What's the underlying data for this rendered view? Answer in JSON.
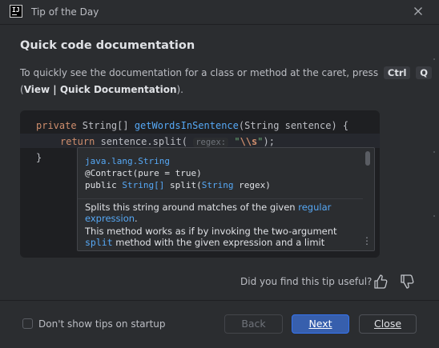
{
  "window": {
    "title": "Tip of the Day",
    "icon_letters": "IJ"
  },
  "tip": {
    "heading": "Quick code documentation",
    "desc_line1": "To quickly see the documentation for a class or method at the caret, press",
    "keys": [
      "Ctrl",
      "Q"
    ],
    "desc_line2_open": "(",
    "menu_path": "View | Quick Documentation",
    "desc_line2_close": ")."
  },
  "code": {
    "line1": {
      "kw": "private",
      "type": " String[] ",
      "fn": "getWordsInSentence",
      "rest": "(String sentence) {"
    },
    "line2": {
      "kw": "return",
      "obj": " sentence.",
      "fn": "split",
      "paren": "(",
      "hint": "regex:",
      "str_open": " \"",
      "esc": "\\\\s",
      "str_close": "\"",
      "end": ");"
    },
    "line3": "}"
  },
  "popup": {
    "pkg": "java.lang.String",
    "annotation": "@Contract(pure = true)",
    "sig_public": "public ",
    "sig_type": "String[]",
    "sig_method": " split(",
    "sig_param_type": "String",
    "sig_param": " regex)",
    "doc_line1_pre": "Splits this string around matches of the given ",
    "doc_link1": "regular",
    "doc_link2": "expression",
    "doc_line2_post": ".",
    "doc_line3": "This method works as if by invoking the two-argument",
    "doc_mono": "split",
    "doc_line4_post": " method with the given expression and a limit"
  },
  "feedback": {
    "question": "Did you find this tip useful?"
  },
  "footer": {
    "checkbox_label": "Don't show tips on startup",
    "checkbox_checked": false,
    "back_label": "Back",
    "next_label": "Next",
    "close_label": "Close"
  },
  "colors": {
    "accent": "#375fad",
    "background": "#2b2d30",
    "code_bg": "#1e1f22"
  }
}
